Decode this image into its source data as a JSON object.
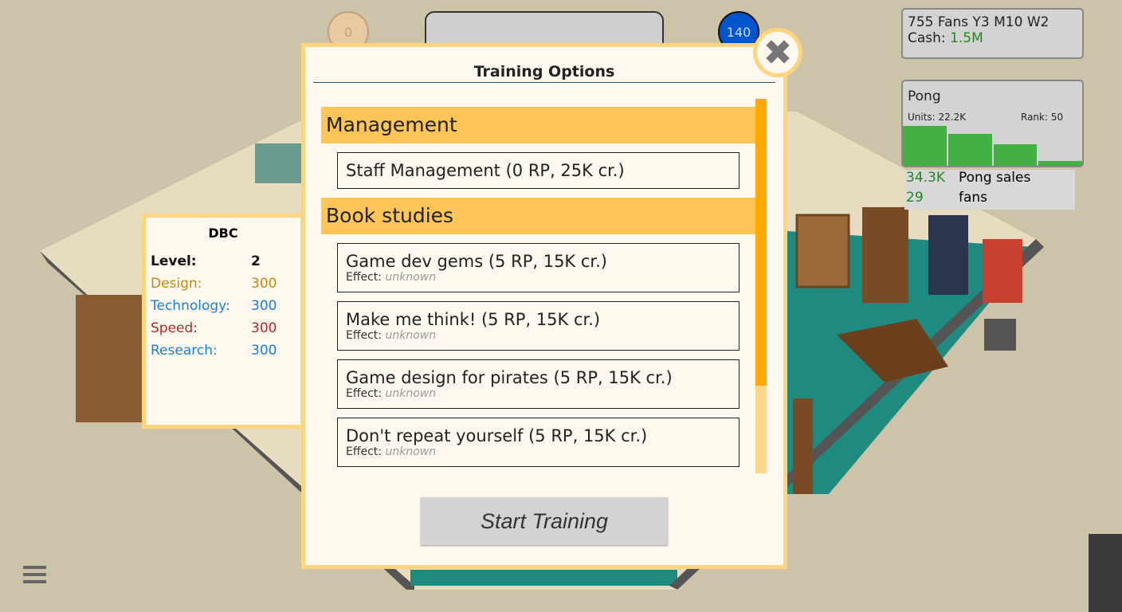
{
  "top_bubbles": {
    "left_value": "0",
    "right_value": "140"
  },
  "status": {
    "fans_date": "755 Fans Y3 M10 W2",
    "cash_label": "Cash:",
    "cash_value": "1.5M"
  },
  "game_panel": {
    "name": "Pong",
    "units": "Units: 22.2K",
    "rank": "Rank: 50",
    "weekly_sales_bars": [
      100,
      80,
      55,
      12
    ],
    "bar_color": "#44b044"
  },
  "game_stats": [
    {
      "value": "34.3K",
      "label": "Pong sales"
    },
    {
      "value": "29",
      "label": "fans"
    }
  ],
  "staff": {
    "name": "DBC",
    "rows": [
      {
        "label": "Level:",
        "value": "2",
        "color": "#111111"
      },
      {
        "label": "Design:",
        "value": "300",
        "color": "#c8860b"
      },
      {
        "label": "Technology:",
        "value": "300",
        "color": "#1a7fd6"
      },
      {
        "label": "Speed:",
        "value": "300",
        "color": "#b02a2a"
      },
      {
        "label": "Research:",
        "value": "300",
        "color": "#1a7fd6"
      }
    ]
  },
  "modal": {
    "title": "Training Options",
    "sections": [
      {
        "label": "Management",
        "items": [
          {
            "label": "Staff Management (0 RP, 25K cr.)"
          }
        ]
      },
      {
        "label": "Book studies",
        "items": [
          {
            "label": "Game dev gems (5 RP, 15K cr.)",
            "effect_label": "Effect:",
            "effect": "unknown"
          },
          {
            "label": "Make me think! (5 RP, 15K cr.)",
            "effect_label": "Effect:",
            "effect": "unknown"
          },
          {
            "label": "Game design for pirates (5 RP, 15K cr.)",
            "effect_label": "Effect:",
            "effect": "unknown"
          },
          {
            "label": "Don't repeat yourself (5 RP, 15K cr.)",
            "effect_label": "Effect:",
            "effect": "unknown"
          }
        ]
      }
    ],
    "start_label": "Start Training",
    "close_icon": "close-x-icon"
  },
  "colors": {
    "accent": "#fdc457",
    "scroll_thumb": "#ffaa00",
    "cash": "#1e8a1e"
  }
}
